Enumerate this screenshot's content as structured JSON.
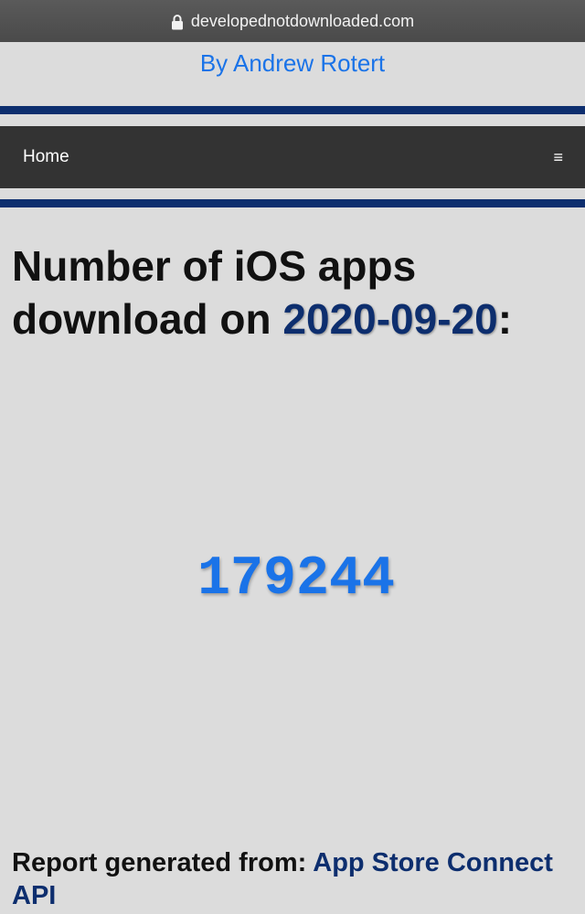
{
  "browser": {
    "url": "developednotdownloaded.com",
    "icon": "lock-icon"
  },
  "header": {
    "author": "By Andrew Rotert"
  },
  "nav": {
    "home_label": "Home",
    "menu_glyph": "≡",
    "menu_icon": "hamburger-menu-icon"
  },
  "main": {
    "title_prefix": "Number of iOS apps download on ",
    "date": "2020-09-20",
    "title_suffix": ":",
    "count": "179244"
  },
  "footer": {
    "report_prefix": "Report generated from: ",
    "source_link": "App Store Connect API"
  },
  "colors": {
    "accent_blue": "#1a73e8",
    "navy": "#0d2e6e",
    "nav_background": "#333333",
    "page_background": "#dcdcdc"
  }
}
